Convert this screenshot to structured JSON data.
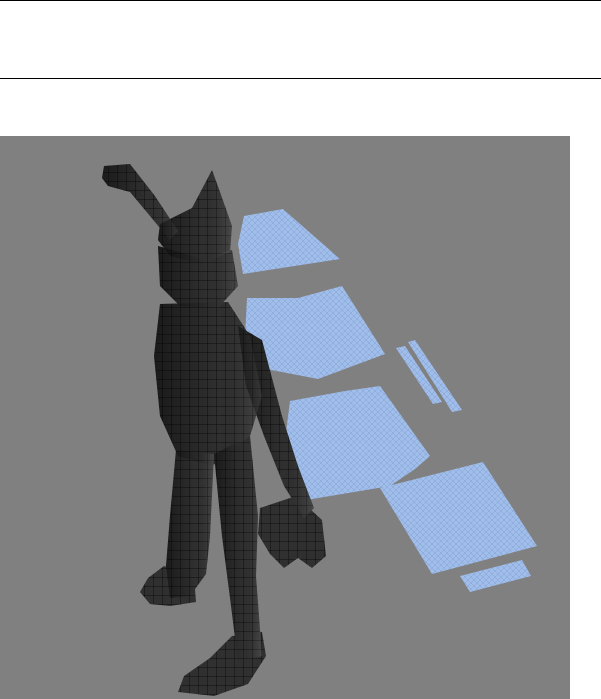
{
  "colors": {
    "page_background": "#ffffff",
    "rule": "#000000",
    "viewport_background": "#808080",
    "uv_patch": "#a3c1f0",
    "mesh_body": "#2a2a2a",
    "wireframe": "#0a0a0a"
  },
  "icons": {
    "model": "character-mesh-icon"
  }
}
